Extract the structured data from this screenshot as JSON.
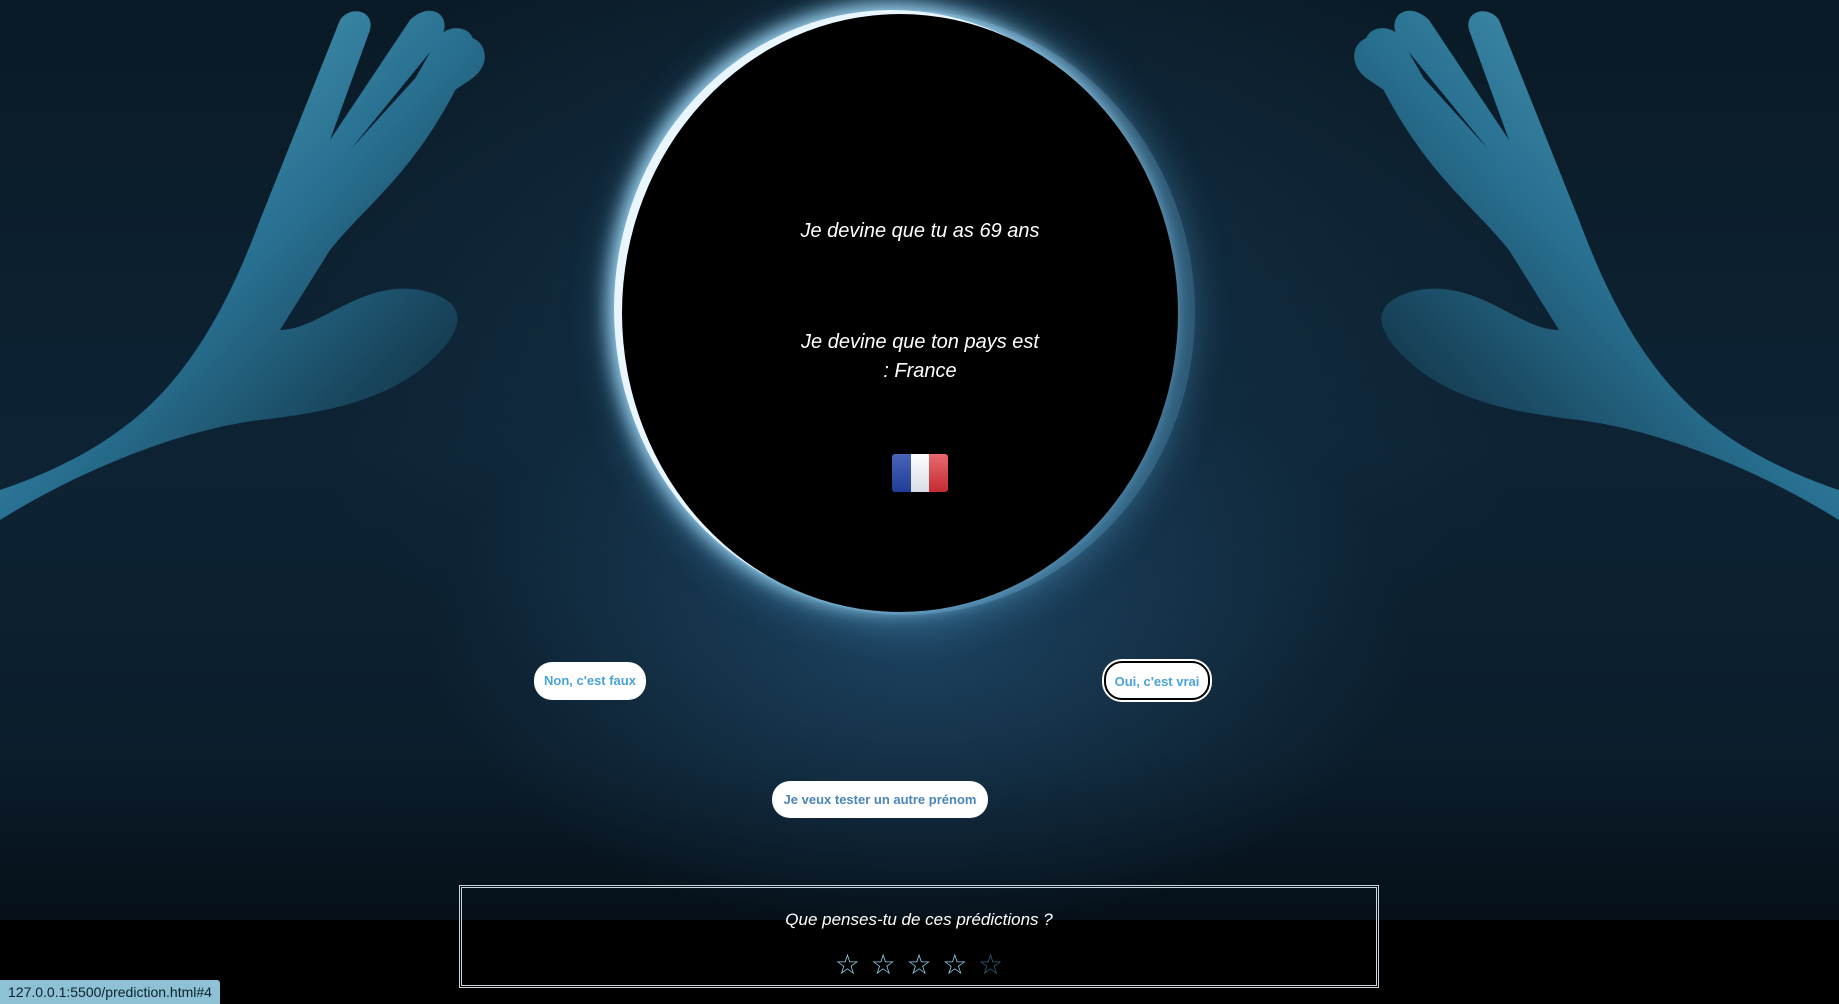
{
  "prediction": {
    "age_text": "Je devine que tu as 69 ans",
    "country_text": "Je devine que ton pays est : France",
    "flag_icon": "france-flag-icon"
  },
  "buttons": {
    "no_label": "Non, c'est faux",
    "yes_label": "Oui, c'est vrai",
    "other_name_label": "Je veux tester un autre prénom"
  },
  "feedback": {
    "question": "Que penses-tu de ces prédictions ?",
    "rating": 4,
    "max_rating": 5,
    "stars": [
      "☆",
      "☆",
      "☆",
      "☆",
      "☆"
    ]
  },
  "status_bar": {
    "url": "127.0.0.1:5500/prediction.html#4"
  },
  "colors": {
    "button_text": "#4aa3d8",
    "star_active": "#8fd0ee",
    "star_inactive": "#2f5f7c"
  }
}
